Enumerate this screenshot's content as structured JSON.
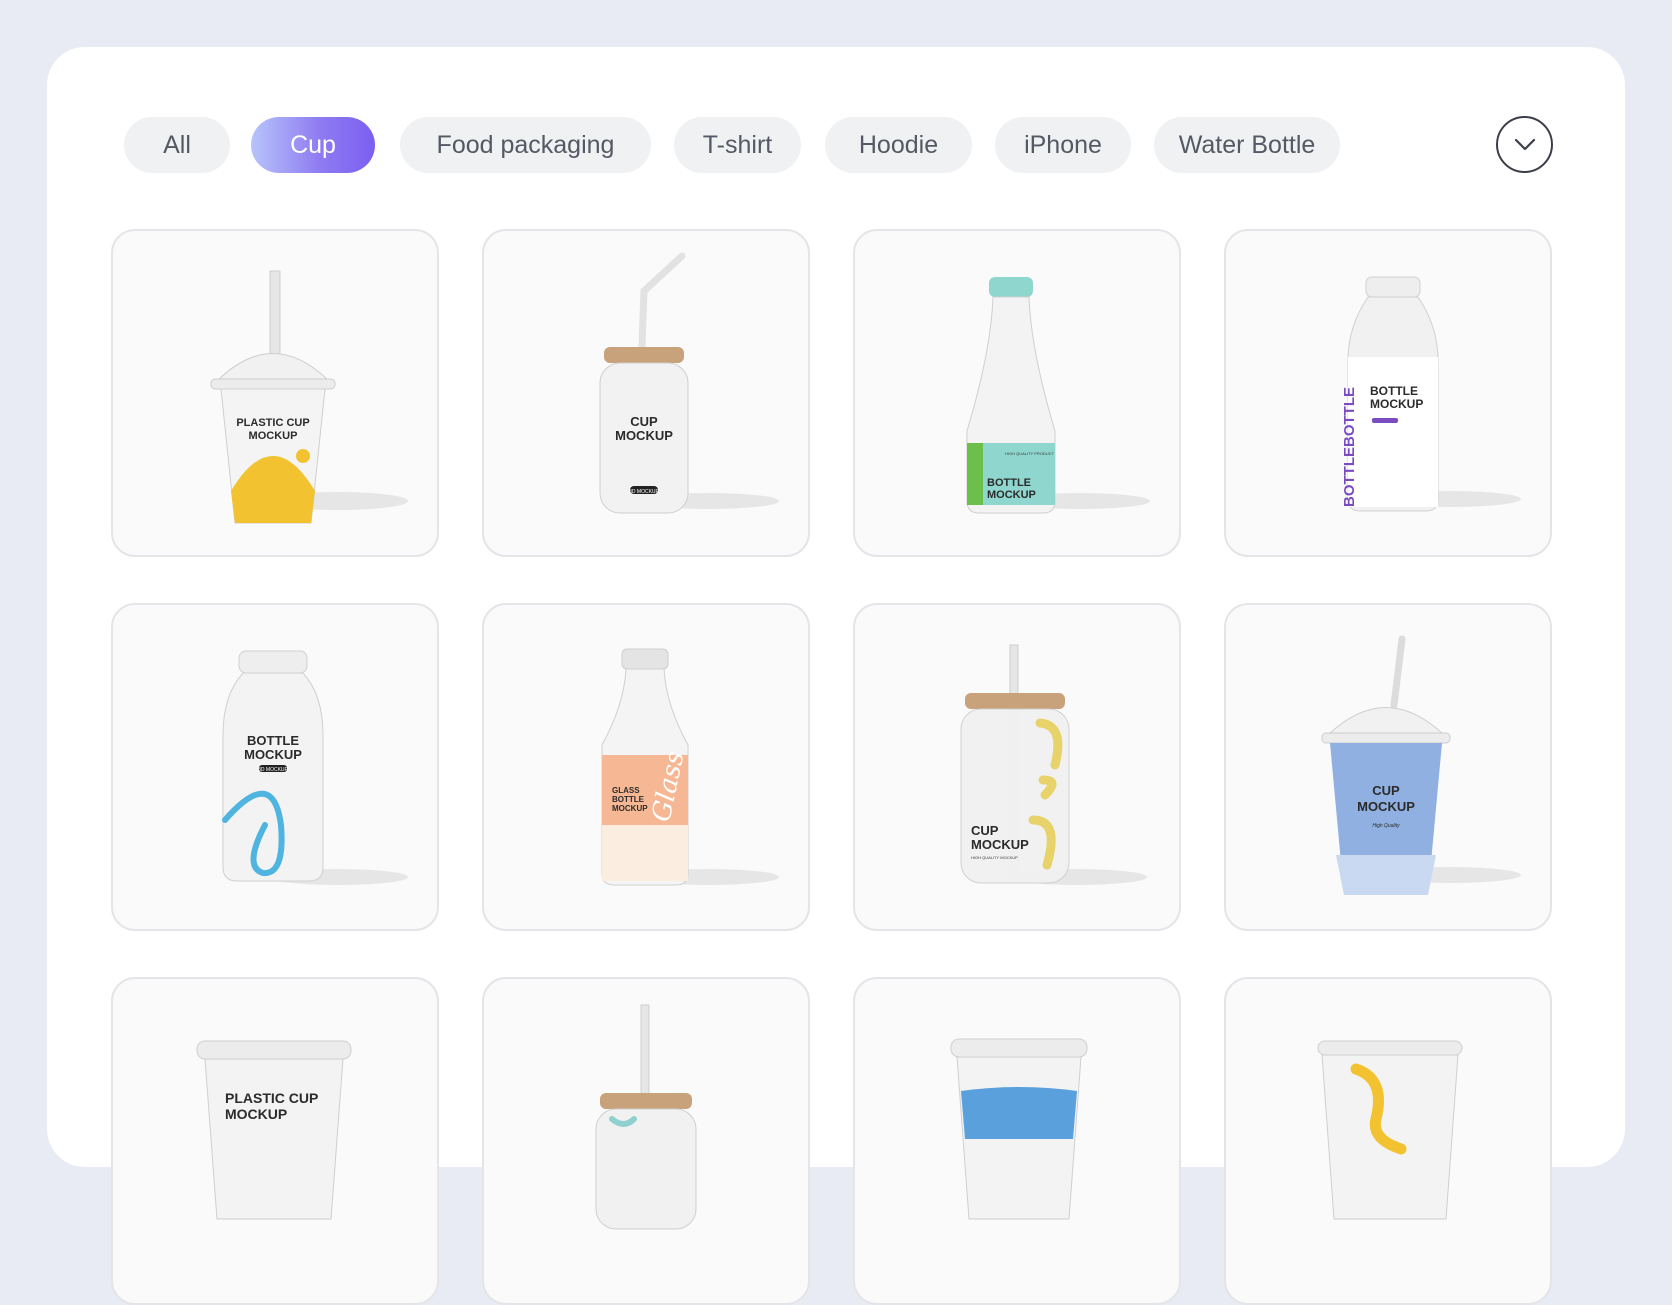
{
  "filters": [
    {
      "label": "All",
      "active": false
    },
    {
      "label": "Cup",
      "active": true
    },
    {
      "label": "Food packaging",
      "active": false
    },
    {
      "label": "T-shirt",
      "active": false
    },
    {
      "label": "Hoodie",
      "active": false
    },
    {
      "label": "iPhone",
      "active": false
    },
    {
      "label": "Water Bottle",
      "active": false
    }
  ],
  "more_button": {
    "icon": "chevron-down-icon"
  },
  "cards": [
    {
      "type": "dome-cup",
      "text": [
        "PLASTIC CUP",
        "MOCKUP"
      ],
      "accent": "#f2c230"
    },
    {
      "type": "glass-can",
      "text": [
        "CUP",
        "MOCKUP"
      ],
      "tag": "3D MOCKUP",
      "accent": "#c8a27a"
    },
    {
      "type": "tall-bottle",
      "text": [
        "BOTTLE",
        "MOCKUP"
      ],
      "small": "HIGH QUALITY PRODUCT",
      "accent": "#8fd6cf"
    },
    {
      "type": "white-bottle",
      "text": [
        "BOTTLE",
        "MOCKUP"
      ],
      "vertical": "BOTTLEBOTTLE",
      "accent": "#7a4cc0"
    },
    {
      "type": "milk-bottle",
      "text": [
        "BOTTLE",
        "MOCKUP"
      ],
      "tag": "3D MOCKUP",
      "accent": "#4fb4e0"
    },
    {
      "type": "glass-milk-bottle",
      "text": [
        "GLASS",
        "BOTTLE",
        "MOCKUP"
      ],
      "script": "Glass",
      "accent": "#f6b894"
    },
    {
      "type": "glass-can-straw",
      "text": [
        "CUP",
        "MOCKUP"
      ],
      "small": "HIGH QUALITY MOCKUP",
      "accent": "#e8d36a"
    },
    {
      "type": "blue-dome-cup",
      "text": [
        "CUP",
        "MOCKUP"
      ],
      "small": "High Quality",
      "accent": "#8fb0e0"
    },
    {
      "type": "flat-lid-cup",
      "text": [
        "PLASTIC CUP",
        "MOCKUP"
      ],
      "accent": "#dcdcdc"
    },
    {
      "type": "glass-can-partial",
      "accent": "#c8a27a"
    },
    {
      "type": "blue-band-cup",
      "accent": "#5aa0dc"
    },
    {
      "type": "yellow-ribbon-cup",
      "accent": "#f2c230"
    }
  ]
}
